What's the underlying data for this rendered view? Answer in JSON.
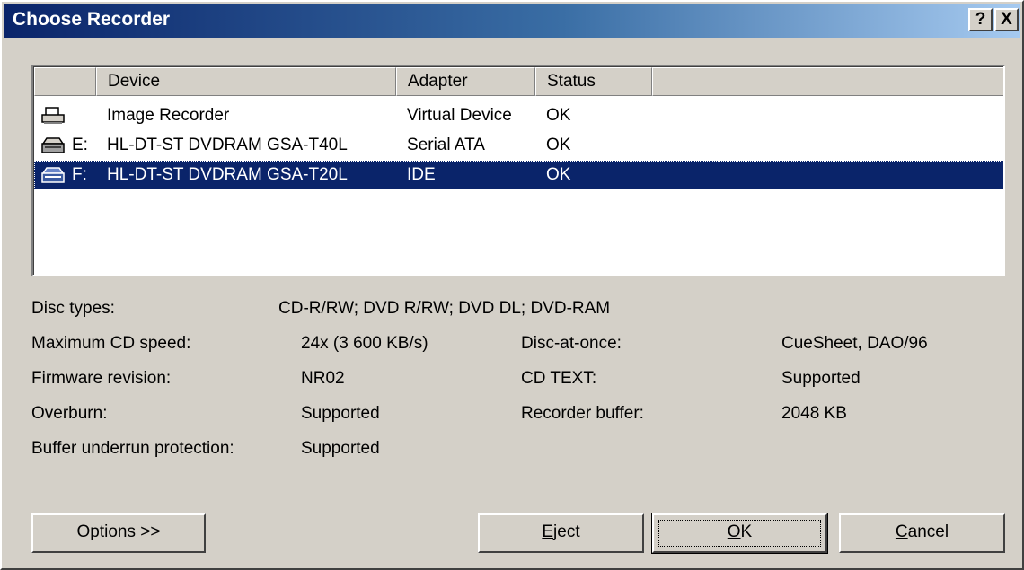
{
  "window": {
    "title": "Choose Recorder",
    "help_label": "?",
    "close_label": "X",
    "titlebar_gradient": [
      "#0a246a",
      "#a6caf0"
    ]
  },
  "list": {
    "headers": {
      "device": "Device",
      "adapter": "Adapter",
      "status": "Status"
    },
    "rows": [
      {
        "icon": "image-recorder-icon",
        "drive": "",
        "device": "Image Recorder",
        "adapter": "Virtual Device",
        "status": "OK",
        "selected": false
      },
      {
        "icon": "optical-drive-icon",
        "drive": "E:",
        "device": "HL-DT-ST DVDRAM GSA-T40L",
        "adapter": "Serial ATA",
        "status": "OK",
        "selected": false
      },
      {
        "icon": "optical-drive-icon",
        "drive": "F:",
        "device": "HL-DT-ST DVDRAM GSA-T20L",
        "adapter": "IDE",
        "status": "OK",
        "selected": true
      }
    ],
    "selection_color": "#0a246a"
  },
  "info": {
    "disc_types_label": "Disc types:",
    "disc_types_value": "CD-R/RW; DVD R/RW; DVD DL; DVD-RAM",
    "max_speed_label": "Maximum CD speed:",
    "max_speed_value": "24x (3 600 KB/s)",
    "firmware_label": "Firmware revision:",
    "firmware_value": "NR02",
    "overburn_label": "Overburn:",
    "overburn_value": "Supported",
    "underrun_label": "Buffer underrun protection:",
    "underrun_value": "Supported",
    "dao_label": "Disc-at-once:",
    "dao_value": "CueSheet, DAO/96",
    "cdtext_label": "CD TEXT:",
    "cdtext_value": "Supported",
    "buffer_label": "Recorder buffer:",
    "buffer_value": "2048 KB"
  },
  "buttons": {
    "options": "Options >>",
    "eject_accel": "E",
    "eject_rest": "ject",
    "ok_accel": "O",
    "ok_rest": "K",
    "cancel_accel": "C",
    "cancel_rest": "ancel"
  }
}
